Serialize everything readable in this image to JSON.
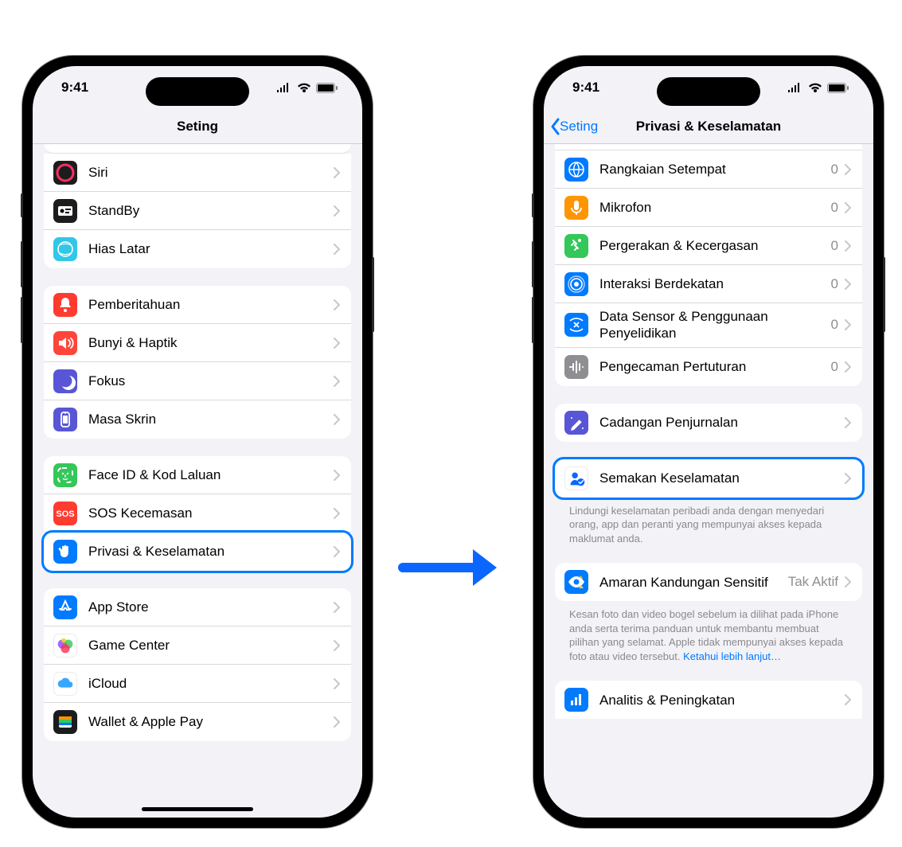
{
  "status": {
    "time": "9:41"
  },
  "phone1": {
    "nav_title": "Seting",
    "groups": [
      {
        "partial_top": true,
        "rows": [
          {
            "label": "Siri",
            "icon": "siri"
          },
          {
            "label": "StandBy",
            "icon": "standby"
          },
          {
            "label": "Hias Latar",
            "icon": "wallpaper"
          }
        ]
      },
      {
        "rows": [
          {
            "label": "Pemberitahuan",
            "icon": "notifications"
          },
          {
            "label": "Bunyi & Haptik",
            "icon": "sounds"
          },
          {
            "label": "Fokus",
            "icon": "focus"
          },
          {
            "label": "Masa Skrin",
            "icon": "screentime"
          }
        ]
      },
      {
        "rows": [
          {
            "label": "Face ID & Kod Laluan",
            "icon": "faceid"
          },
          {
            "label": "SOS Kecemasan",
            "icon": "sos"
          },
          {
            "label": "Privasi & Keselamatan",
            "icon": "privacy",
            "highlighted": true
          }
        ]
      },
      {
        "rows": [
          {
            "label": "App Store",
            "icon": "appstore"
          },
          {
            "label": "Game Center",
            "icon": "gamecenter"
          },
          {
            "label": "iCloud",
            "icon": "icloud"
          },
          {
            "label": "Wallet & Apple Pay",
            "icon": "wallet"
          }
        ]
      }
    ]
  },
  "phone2": {
    "nav_back": "Seting",
    "nav_title": "Privasi & Keselamatan",
    "groups": [
      {
        "partial_top": true,
        "rows": [
          {
            "label": "Rangkaian Setempat",
            "icon": "localnet",
            "detail": "0"
          },
          {
            "label": "Mikrofon",
            "icon": "microphone",
            "detail": "0"
          },
          {
            "label": "Pergerakan & Kecergasan",
            "icon": "motion",
            "detail": "0"
          },
          {
            "label": "Interaksi Berdekatan",
            "icon": "nearby",
            "detail": "0"
          },
          {
            "label": "Data Sensor & Penggunaan Penyelidikan",
            "icon": "sensor",
            "detail": "0"
          },
          {
            "label": "Pengecaman Pertuturan",
            "icon": "speech",
            "detail": "0"
          }
        ]
      },
      {
        "rows": [
          {
            "label": "Cadangan Penjurnalan",
            "icon": "journal"
          }
        ]
      },
      {
        "rows": [
          {
            "label": "Semakan Keselamatan",
            "icon": "safetycheck",
            "white_icon": true,
            "highlighted": true
          }
        ],
        "footer": "Lindungi keselamatan peribadi anda dengan menyedari orang, app dan peranti yang mempunyai akses kepada maklumat anda."
      },
      {
        "rows": [
          {
            "label": "Amaran Kandungan Sensitif",
            "icon": "sensitive",
            "detail": "Tak Aktif"
          }
        ],
        "footer": "Kesan foto dan video bogel sebelum ia dilihat pada iPhone anda serta terima panduan untuk membantu membuat pilihan yang selamat. Apple tidak mempunyai akses kepada foto atau video tersebut. ",
        "footer_link": "Ketahui lebih lanjut…"
      },
      {
        "partial_bottom": true,
        "rows": [
          {
            "label": "Analitis & Peningkatan",
            "icon": "analytics"
          }
        ]
      }
    ]
  }
}
